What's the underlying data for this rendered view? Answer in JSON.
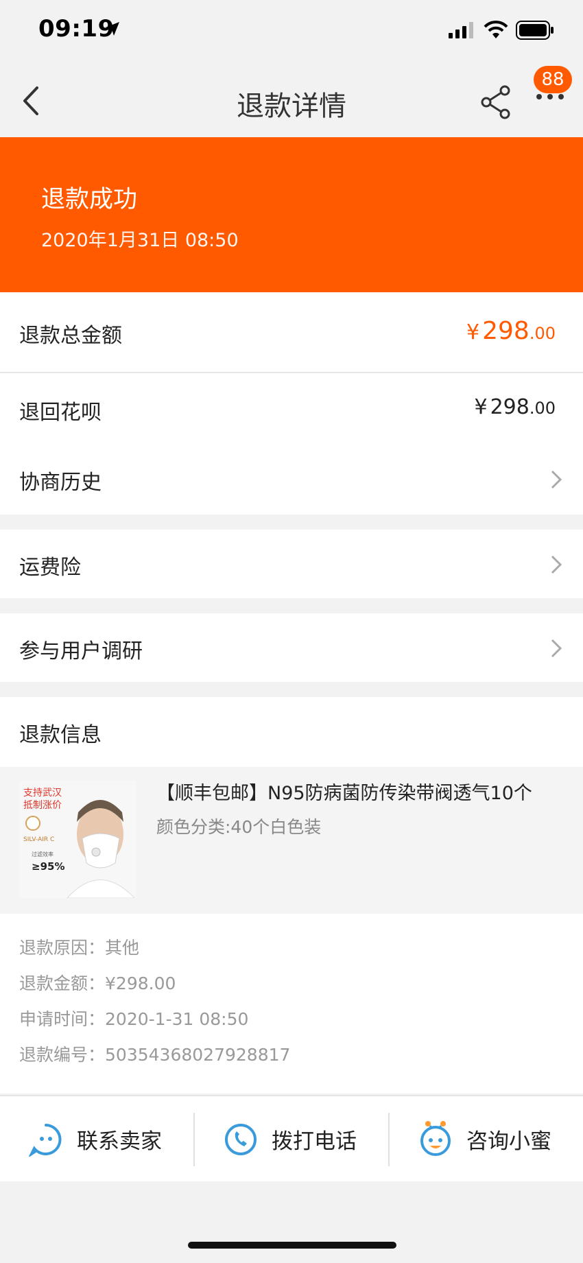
{
  "status_bar": {
    "time": "09:19"
  },
  "nav": {
    "title": "退款详情",
    "badge": "88"
  },
  "banner": {
    "title": "退款成功",
    "time": "2020年1月31日 08:50"
  },
  "total": {
    "label": "退款总金额",
    "yen": "¥",
    "int": "298",
    "dec": ".00"
  },
  "huabei": {
    "label": "退回花呗",
    "yen": "¥",
    "int": "298",
    "dec": ".00"
  },
  "rows": {
    "history": "协商历史",
    "insurance": "运费险",
    "survey": "参与用户调研",
    "refund_info": "退款信息"
  },
  "product": {
    "title": "【顺丰包邮】N95防病菌防传染带阀透气10个",
    "spec": "颜色分类:40个白色装",
    "img_text": {
      "line1": "支持武汉",
      "line2": "抵制涨价",
      "brand": "SILV-AIR C",
      "eff_label": "过滤效率",
      "eff": "≥95%"
    }
  },
  "info": {
    "reason_label": "退款原因：",
    "reason": "其他",
    "amount_label": "退款金额：",
    "amount": "¥298.00",
    "time_label": "申请时间：",
    "time": "2020-1-31 08:50",
    "number_label": "退款编号：",
    "number": "50354368027928817"
  },
  "actions": {
    "contact_seller": "联系卖家",
    "call": "拨打电话",
    "consult": "咨询小蜜"
  },
  "colors": {
    "accent": "#ff5a00",
    "icon_blue": "#3a9bdc"
  },
  "icons": [
    "location-arrow-icon",
    "signal-icon",
    "wifi-icon",
    "battery-icon",
    "back-icon",
    "share-icon",
    "more-icon",
    "chevron-right-icon",
    "chat-face-icon",
    "phone-icon",
    "bee-icon"
  ]
}
